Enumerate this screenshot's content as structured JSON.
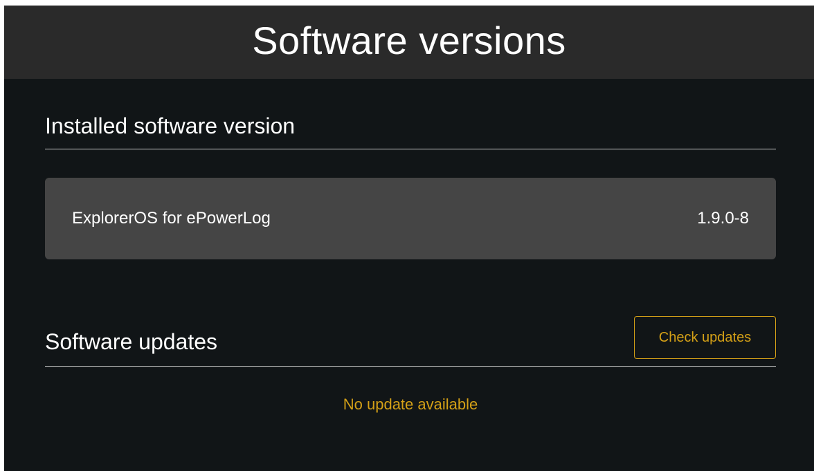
{
  "header": {
    "title": "Software versions"
  },
  "installed": {
    "heading": "Installed software version",
    "software_name": "ExplorerOS for ePowerLog",
    "software_version": "1.9.0-8"
  },
  "updates": {
    "heading": "Software updates",
    "check_button_label": "Check updates",
    "status": "No update available"
  },
  "colors": {
    "background": "#111517",
    "header_background": "#2a2a2a",
    "card_background": "#454545",
    "accent": "#d4a017",
    "text": "#ffffff"
  }
}
